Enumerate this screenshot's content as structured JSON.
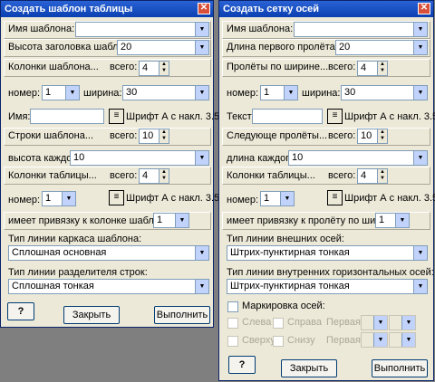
{
  "left": {
    "title": "Создать шаблон таблицы",
    "template_name_label": "Имя шаблона:",
    "template_name_value": "",
    "header_height_label": "Высота заголовка шаблона",
    "header_height_value": "20",
    "template_columns_label": "Колонки шаблона...",
    "total_label": "всего:",
    "template_columns_total": "4",
    "number_label": "номер:",
    "number_value": "1",
    "width_label": "ширина:",
    "width_value": "30",
    "name_label": "Имя:",
    "font_info": "Шрифт А с накл. 3.5",
    "template_rows_label": "Строки шаблона...",
    "template_rows_total": "10",
    "each_height_label": "высота каждой:",
    "each_height_value": "10",
    "table_columns_label": "Колонки таблицы...",
    "table_columns_total": "4",
    "number2_value": "1",
    "binding_label": "имеет привязку к колонке шаблона:",
    "binding_value": "1",
    "frame_line_label": "Тип линии каркаса шаблона:",
    "frame_line_value": "Сплошная основная",
    "row_sep_label": "Тип линии разделителя строк:",
    "row_sep_value": "Сплошная тонкая",
    "help": "?",
    "close": "Закрыть",
    "run": "Выполнить"
  },
  "right": {
    "title": "Создать сетку осей",
    "template_name_label": "Имя шаблона:",
    "template_name_value": "",
    "first_span_label": "Длина первого пролёта:",
    "first_span_value": "20",
    "spans_width_label": "Пролёты по ширине...",
    "total_label": "всего:",
    "spans_width_total": "4",
    "number_label": "номер:",
    "number_value": "1",
    "width_label": "ширина:",
    "width_value": "30",
    "text_label": "Текст:",
    "font_info": "Шрифт А с накл. 3.5",
    "next_spans_label": "Следующе пролёты...",
    "next_spans_total": "10",
    "each_length_label": "длина каждого:",
    "each_length_value": "10",
    "table_columns_label": "Колонки таблицы...",
    "table_columns_total": "4",
    "number2_value": "1",
    "binding_label": "имеет привязку к пролёту по ширине:",
    "binding_value": "1",
    "outer_axes_label": "Тип линии внешних осей:",
    "outer_axes_value": "Штрих-пунктирная тонкая",
    "inner_axes_label": "Тип линии внутренних горизонтальных осей:",
    "inner_axes_value": "Штрих-пунктирная тонкая",
    "marking_label": "Маркировка осей:",
    "left_cb": "Слева",
    "right_cb": "Справа",
    "first_label": "Первая:",
    "top_cb": "Сверху",
    "bottom_cb": "Снизу",
    "first2_label": "Первая:",
    "help": "?",
    "close": "Закрыть",
    "run": "Выполнить"
  }
}
